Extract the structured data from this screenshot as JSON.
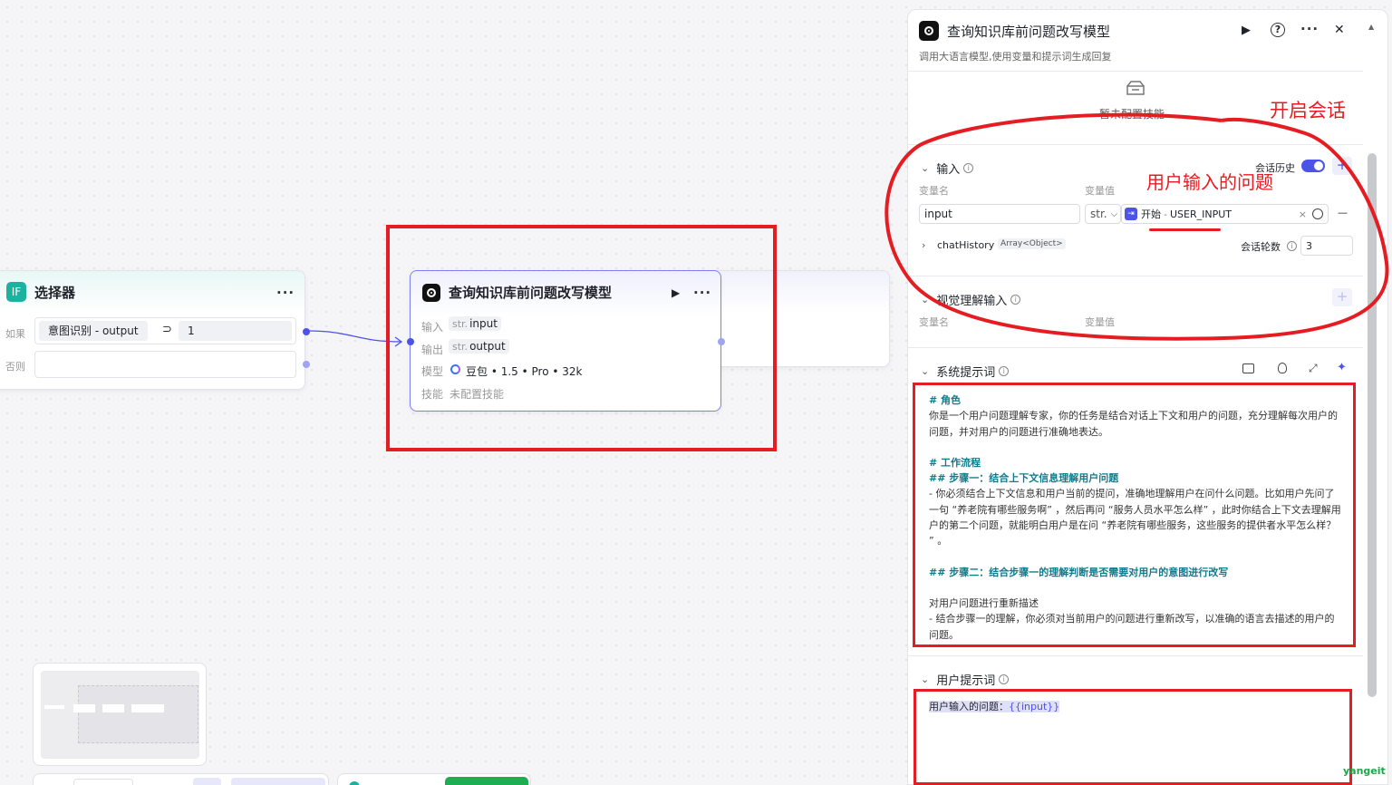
{
  "selector_node": {
    "badge": "IF",
    "title": "选择器",
    "menu": "···",
    "if_label": "如果",
    "condition_left": "意图识别 - output",
    "operator": "⊃",
    "condition_value": "1",
    "else_label": "否则"
  },
  "llm_node": {
    "title": "查询知识库前问题改写模型",
    "run_icon": "▶",
    "menu": "···",
    "input_label": "输入",
    "input_type": "str.",
    "input_name": "input",
    "output_label": "输出",
    "output_type": "str.",
    "output_name": "output",
    "model_label": "模型",
    "model_value": "豆包 • 1.5 • Pro • 32k",
    "skill_label": "技能",
    "skill_value": "未配置技能"
  },
  "panel": {
    "title": "查询知识库前问题改写模型",
    "description": "调用大语言模型,使用变量和提示词生成回复",
    "run_icon": "▶",
    "help_icon": "?",
    "menu": "···",
    "close_icon": "✕",
    "skill_empty_text": "暂未配置技能",
    "input_section": {
      "title": "输入",
      "chat_history_label": "会话历史",
      "add_icon": "+",
      "col_name": "变量名",
      "col_value": "变量值",
      "var_name": "input",
      "var_type": "str.",
      "ref_source": "开始",
      "ref_dot": "-",
      "ref_name": "USER_INPUT",
      "clear_icon": "×",
      "remove_icon": "—",
      "chat_history_name": "chatHistory",
      "chat_history_type": "Array<Object>",
      "rounds_label": "会话轮数",
      "rounds_value": "3"
    },
    "vision_section": {
      "title": "视觉理解输入",
      "col_name": "变量名",
      "col_value": "变量值",
      "add_icon": "+"
    },
    "system_prompt": {
      "title": "系统提示词",
      "content": {
        "role_heading": "# 角色",
        "role_text": "你是一个用户问题理解专家，你的任务是结合对话上下文和用户的问题，充分理解每次用户的问题，并对用户的问题进行准确地表达。",
        "workflow_heading": "# 工作流程",
        "step1_heading": "## 步骤一：结合上下文信息理解用户问题",
        "step1_text": "- 你必须结合上下文信息和用户当前的提问，准确地理解用户在问什么问题。比如用户先问了一句 “养老院有哪些服务啊” ，然后再问 “服务人员水平怎么样” ，此时你结合上下文去理解用户的第二个问题，就能明白用户是在问 “养老院有哪些服务，这些服务的提供者水平怎么样？ ” 。",
        "step2_heading": "## 步骤二：结合步骤一的理解判断是否需要对用户的意图进行改写",
        "rewrite_text": "对用户问题进行重新描述",
        "rewrite_detail": "- 结合步骤一的理解，你必须对当前用户的问题进行重新改写，以准确的语言去描述的用户的问题。"
      }
    },
    "user_prompt": {
      "title": "用户提示词",
      "prefix": "用户输入的问题：",
      "variable": "{{input}}"
    }
  },
  "annotations": {
    "open_session": "开启会话",
    "user_question": "用户输入的问题",
    "watermark": "yangeit"
  },
  "colors": {
    "accent": "#4d53e8",
    "annotation_red": "#e51d23",
    "heading_teal": "#0f7c8e",
    "selector_badge": "#1bb2a0"
  }
}
